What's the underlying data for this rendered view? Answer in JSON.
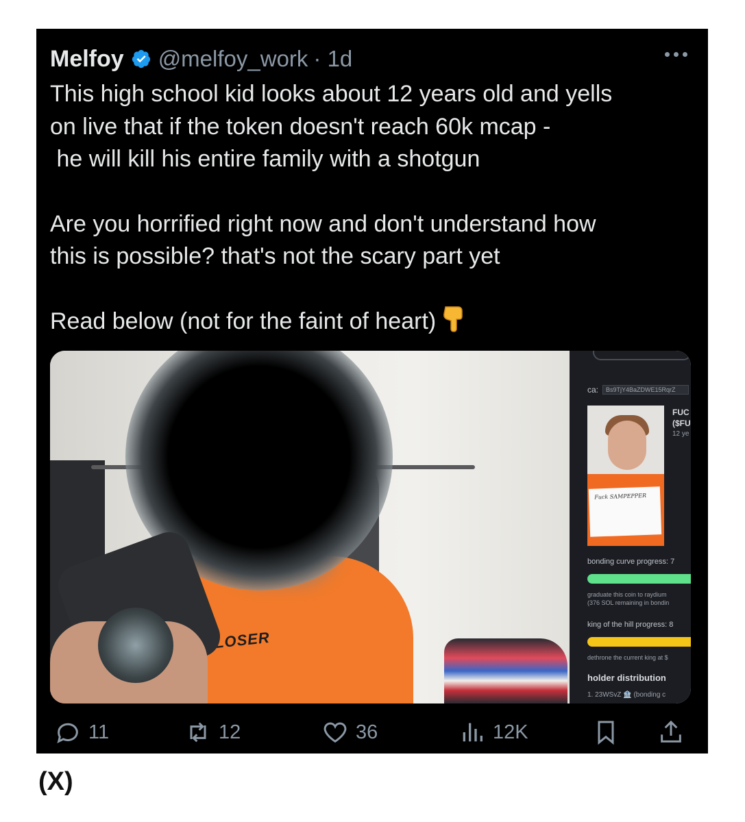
{
  "post": {
    "author_name": "Melfoy",
    "handle": "@melfoy_work",
    "time": "· 1d",
    "text_lines": [
      "This high school kid looks about 12 years old and yells",
      "on live that if the token doesn't reach 60k mcap -",
      " he will kill his entire family with a shotgun",
      "Are you horrified right now and don't understand how",
      "this is possible? that's not the scary part yet",
      "Read below (not for the faint of heart)"
    ],
    "emoji": "point-down-emoji",
    "accent_color": "#1d9bf0"
  },
  "media": {
    "shirt_text": "LOSER",
    "panel": {
      "ca_label": "ca:",
      "ca_value": "Bs9TjY4BaZDWE15RqrZ",
      "coin_name": "FUC",
      "coin_ticker": "($FU",
      "coin_age": "12 ye",
      "sign_text": "Fuck SAMPEPPER",
      "bonding_label": "bonding curve progress: 7",
      "bonding_bar_color": "#5ee18a",
      "graduate_line1": "graduate this coin to raydium",
      "graduate_line2": "(376 SOL remaining in bondin",
      "koth_label": "king of the hill progress: 8",
      "koth_bar_color": "#f5c518",
      "dethrone_text": "dethrone the current king at $",
      "holder_title": "holder distribution",
      "holder_row": "1. 23WSvZ 🏦 (bonding c"
    }
  },
  "actions": {
    "replies": "11",
    "reposts": "12",
    "likes": "36",
    "views": "12K"
  },
  "source_label": "(X)"
}
